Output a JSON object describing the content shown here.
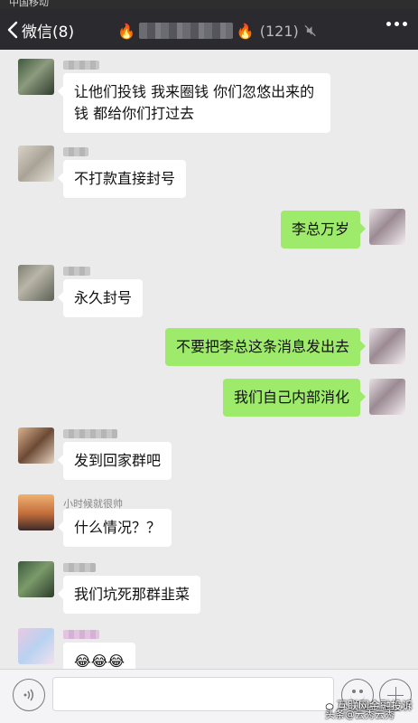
{
  "statusbar": {
    "text": "中国移动"
  },
  "navbar": {
    "back_label": "微信(8)",
    "group_count": "(121)",
    "icons": [
      "chevron-left-icon",
      "flame-icon",
      "mute-icon",
      "more-icon"
    ]
  },
  "messages": [
    {
      "side": "left",
      "nickname": "",
      "text": "让他们投钱 我来圈钱 你们忽悠出来的\n钱 都给你们打过去"
    },
    {
      "side": "left",
      "nickname": "",
      "text": "不打款直接封号"
    },
    {
      "side": "right",
      "text": "李总万岁"
    },
    {
      "side": "left",
      "nickname": "",
      "text": "永久封号"
    },
    {
      "side": "right",
      "text": "不要把李总这条消息发出去"
    },
    {
      "side": "right",
      "text": "我们自己内部消化"
    },
    {
      "side": "left",
      "nickname": "",
      "text": "发到回家群吧"
    },
    {
      "side": "left",
      "nickname": "小时候就很帅",
      "text": "什么情况？？"
    },
    {
      "side": "left",
      "nickname": "",
      "text": "我们坑死那群韭菜"
    },
    {
      "side": "left",
      "nickname": "",
      "text": "😂😂😂"
    }
  ],
  "inputbar": {
    "placeholder": "",
    "icons": [
      "voice-icon",
      "emoji-icon",
      "plus-icon"
    ]
  },
  "watermark": {
    "line1": "互联网金融投诉",
    "line2": "头条@云秀云秀"
  },
  "colors": {
    "navbar": "#2b2b2f",
    "chat_bg": "#ebebeb",
    "bubble_self": "#9eea6a",
    "bubble_other": "#ffffff"
  }
}
